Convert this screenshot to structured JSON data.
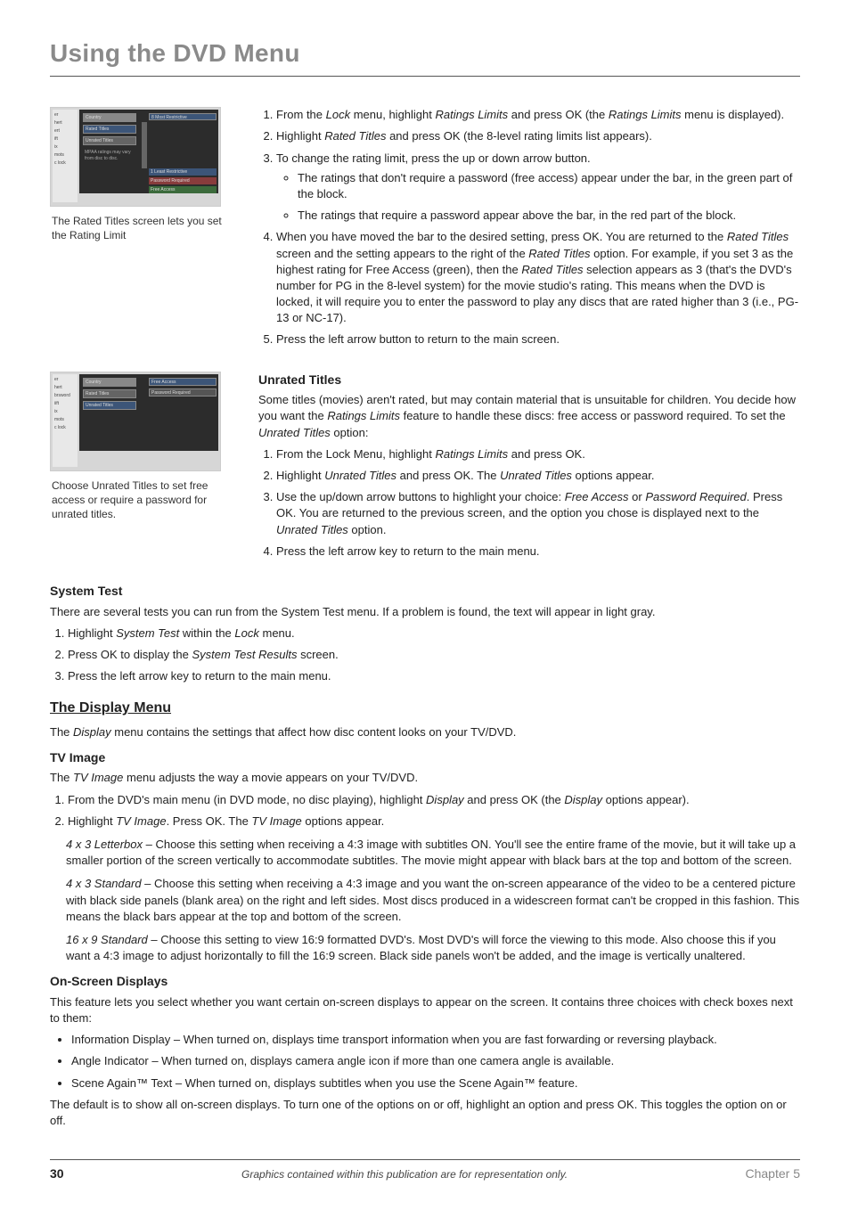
{
  "pageTitle": "Using the DVD Menu",
  "fig1": {
    "side": [
      "er",
      "hert",
      "ert",
      "ift",
      "ix",
      "mots",
      "c lock"
    ],
    "labels": [
      "Country",
      "Rated Titles",
      "Unrated Titles",
      "MPAA ratings may vary from disc to disc.",
      "8  Most Restrictive",
      "1  Least Restrictive",
      "Password Required",
      "Free Access"
    ],
    "caption": "The Rated Titles screen lets you set the Rating Limit"
  },
  "fig2": {
    "side": [
      "er",
      "hert",
      "brsword",
      "iift",
      "ix",
      "mots",
      "c lock"
    ],
    "labels": [
      "Country",
      "Rated Titles",
      "Unrated Titles",
      "Free Access",
      "Password Required"
    ],
    "caption": "Choose Unrated Titles to set free access or require a password for unrated titles."
  },
  "steps1": {
    "i1a": "From the ",
    "i1b": "Lock",
    "i1c": " menu, highlight ",
    "i1d": "Ratings Limits",
    "i1e": " and press OK (the ",
    "i1f": "Ratings Limits",
    "i1g": " menu is displayed).",
    "i2a": "Highlight ",
    "i2b": "Rated Titles",
    "i2c": " and press OK (the 8-level rating limits list appears).",
    "i3": "To change the rating limit, press the up or down arrow button.",
    "b1": "The ratings that don't require a password (free access) appear under the bar, in the green part of the block.",
    "b2": "The ratings that require a password appear above the bar, in the red part of the block.",
    "i4a": "When you have moved the bar to the desired setting, press OK. You are returned to the ",
    "i4b": "Rated Titles",
    "i4c": " screen and the setting appears to the right of the ",
    "i4d": "Rated Titles",
    "i4e": " option. For example, if you set 3 as the highest rating for Free Access (green), then the ",
    "i4f": "Rated Titles",
    "i4g": " selection appears as 3 (that's the DVD's number for PG in the 8-level system) for the movie studio's rating. This means when the DVD is locked, it will require you to enter the password to play any discs that are rated higher than 3 (i.e., PG-13 or NC-17).",
    "i5": "Press the left arrow button to return to the main screen."
  },
  "unrated": {
    "heading": "Unrated Titles",
    "p1a": "Some titles (movies) aren't rated, but may contain material that is unsuitable for children. You decide how you want the ",
    "p1b": "Ratings Limits",
    "p1c": " feature to handle these discs: free access or password required. To set the ",
    "p1d": "Unrated Titles",
    "p1e": " option:",
    "s1a": "From the Lock Menu, highlight ",
    "s1b": "Ratings Limits",
    "s1c": " and press OK.",
    "s2a": "Highlight ",
    "s2b": "Unrated Titles",
    "s2c": " and press OK. The ",
    "s2d": "Unrated Titles",
    "s2e": " options appear.",
    "s3a": "Use the up/down arrow buttons to highlight your choice: ",
    "s3b": "Free Access",
    "s3c": " or ",
    "s3d": "Password Required",
    "s3e": ". Press OK. You are returned to the previous screen, and the option you chose is displayed next to the ",
    "s3f": "Unrated Titles",
    "s3g": " option.",
    "s4": "Press the left arrow key to return to the main menu."
  },
  "systemTest": {
    "heading": "System Test",
    "intro": "There are several tests you can run from the System Test menu. If a problem is found, the text will appear in light gray.",
    "s1a": "Highlight ",
    "s1b": "System Test",
    "s1c": " within the ",
    "s1d": "Lock",
    "s1e": " menu.",
    "s2a": "Press OK to display the ",
    "s2b": "System Test Results",
    "s2c": " screen.",
    "s3": "Press the left arrow key to return to the main menu."
  },
  "displayMenu": {
    "heading": "The Display Menu",
    "p1a": "The ",
    "p1b": "Display",
    "p1c": " menu contains the settings that affect how disc content looks on your TV/DVD."
  },
  "tvImage": {
    "heading": "TV Image",
    "p1a": "The ",
    "p1b": "TV Image",
    "p1c": " menu adjusts the way a movie appears on your TV/DVD.",
    "s1a": "From the DVD's main menu (in DVD mode, no disc playing), highlight ",
    "s1b": "Display",
    "s1c": " and press OK (the ",
    "s1d": "Display",
    "s1e": " options appear).",
    "s2a": "Highlight ",
    "s2b": "TV Image",
    "s2c": ". Press OK. The ",
    "s2d": "TV Image",
    "s2e": " options appear.",
    "o1t": "4 x 3 Letterbox –",
    "o1": "   Choose this setting when receiving a 4:3 image with subtitles ON. You'll see the entire frame of the movie, but it will take up a smaller portion of the screen vertically to accommodate subtitles. The movie might appear with black bars at the top and bottom of the screen.",
    "o2t": "4 x 3 Standard –",
    "o2": "   Choose this setting when receiving a 4:3 image and you want the on-screen appearance of the video to be a centered picture with black side panels (blank area) on the right and left sides. Most discs produced in a widescreen format can't be cropped in this fashion. This means the black bars appear at the top and bottom of the screen.",
    "o3t": "16 x 9 Standard –",
    "o3": "   Choose this setting to view 16:9 formatted DVD's. Most DVD's will force the viewing to this mode. Also choose this if you want a 4:3 image to adjust horizontally to fill the 16:9 screen. Black side panels won't be added, and the image is vertically unaltered."
  },
  "osd": {
    "heading": "On-Screen Displays",
    "intro": "This feature lets you select whether you want certain on-screen displays to appear on the screen. It contains three choices with check boxes next to them:",
    "b1": "Information Display – When turned on, displays time transport information when you are fast forwarding or reversing playback.",
    "b2": "Angle Indicator – When turned on, displays camera angle icon if more than one camera angle is available.",
    "b3": "Scene Again™ Text – When turned on, displays subtitles when you use the Scene Again™ feature.",
    "outro": "The default is to show all on-screen displays. To turn one of the options on or off, highlight an option and press OK. This toggles the option on or off."
  },
  "footer": {
    "page": "30",
    "center": "Graphics contained within this publication are for representation only.",
    "chapter": "Chapter 5"
  }
}
